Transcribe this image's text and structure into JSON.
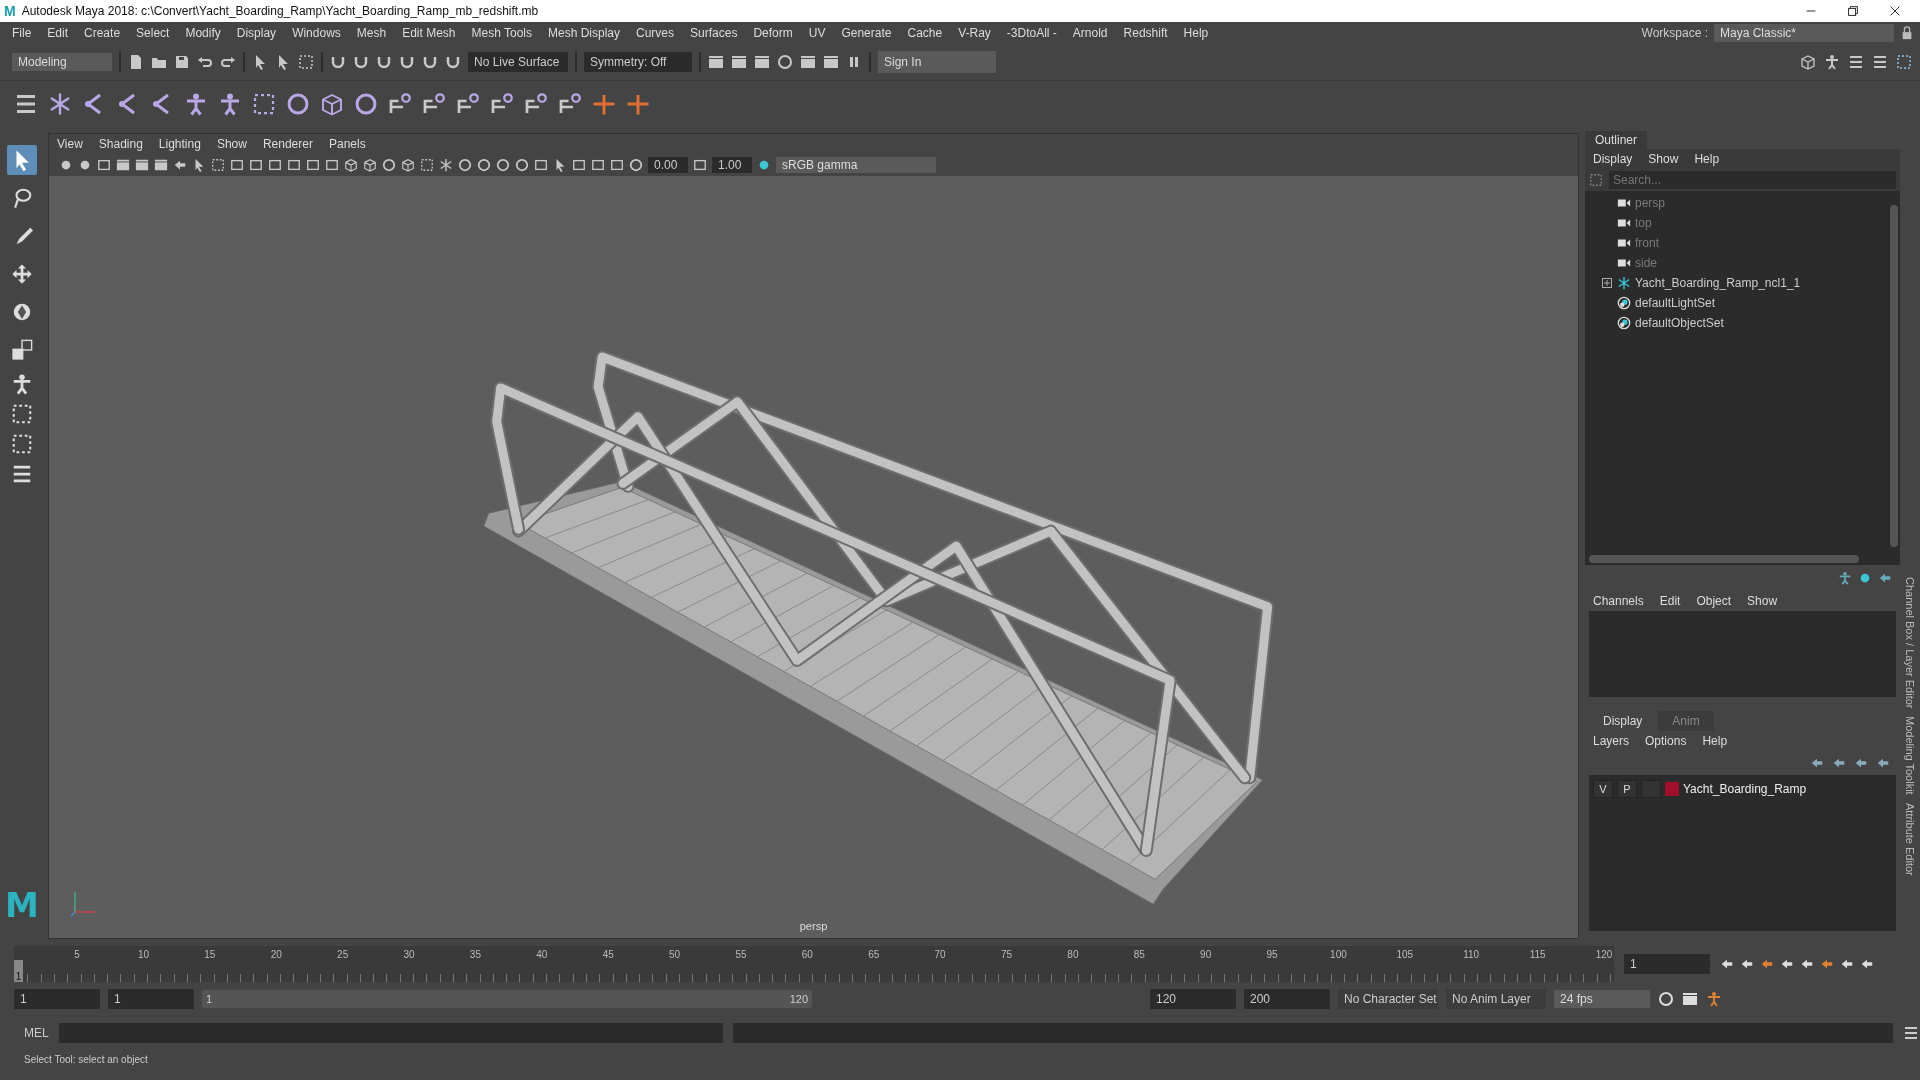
{
  "window": {
    "app_icon": "M",
    "title": "Autodesk Maya 2018: c:\\Convert\\Yacht_Boarding_Ramp\\Yacht_Boarding_Ramp_mb_redshift.mb"
  },
  "menu_bar": [
    "File",
    "Edit",
    "Create",
    "Select",
    "Modify",
    "Display",
    "Windows",
    "Mesh",
    "Edit Mesh",
    "Mesh Tools",
    "Mesh Display",
    "Curves",
    "Surfaces",
    "Deform",
    "UV",
    "Generate",
    "Cache",
    "V-Ray",
    "-3DtoAll -",
    "Arnold",
    "Redshift",
    "Help"
  ],
  "workspace": {
    "label": "Workspace :",
    "value": "Maya Classic*"
  },
  "status_line": {
    "mode": "Modeling",
    "live_surface": "No Live Surface",
    "symmetry": "Symmetry: Off",
    "sign_in": "Sign In"
  },
  "toolbox": [
    {
      "kind": "select",
      "selected": true
    },
    {
      "kind": "lasso",
      "selected": false
    },
    {
      "kind": "paint",
      "selected": false
    },
    {
      "kind": "move",
      "selected": false
    },
    {
      "kind": "rotate",
      "selected": false
    },
    {
      "kind": "scale",
      "selected": false
    }
  ],
  "viewport": {
    "menu": [
      "View",
      "Shading",
      "Lighting",
      "Show",
      "Renderer",
      "Panels"
    ],
    "exposure": "0.00",
    "gamma": "1.00",
    "color_space": "sRGB gamma",
    "camera": "persp",
    "logo": "M"
  },
  "outliner": {
    "title": "Outliner",
    "menu": [
      "Display",
      "Show",
      "Help"
    ],
    "search": {
      "placeholder": "Search..."
    },
    "items": [
      {
        "kind": "camera",
        "label": "persp",
        "expandable": false
      },
      {
        "kind": "camera",
        "label": "top",
        "expandable": false
      },
      {
        "kind": "camera",
        "label": "front",
        "expandable": false
      },
      {
        "kind": "camera",
        "label": "side",
        "expandable": false
      },
      {
        "kind": "transform",
        "label": "Yacht_Boarding_Ramp_ncl1_1",
        "expandable": true
      },
      {
        "kind": "set",
        "label": "defaultLightSet",
        "expandable": false
      },
      {
        "kind": "set",
        "label": "defaultObjectSet",
        "expandable": false
      }
    ]
  },
  "channel_box": {
    "menu": [
      "Channels",
      "Edit",
      "Object",
      "Show"
    ]
  },
  "layer_editor": {
    "tabs": [
      {
        "label": "Display",
        "selected": true
      },
      {
        "label": "Anim",
        "selected": false
      }
    ],
    "menu": [
      "Layers",
      "Options",
      "Help"
    ],
    "layers": [
      {
        "visible": "V",
        "playback": "P",
        "color": "#a0102a",
        "name": "Yacht_Boarding_Ramp"
      }
    ]
  },
  "side_tabs": [
    "Channel Box / Layer Editor",
    "Modeling Toolkit",
    "Attribute Editor"
  ],
  "timeline": {
    "current": "1",
    "ticks": [
      "5",
      "10",
      "15",
      "20",
      "25",
      "30",
      "35",
      "40",
      "45",
      "50",
      "55",
      "60",
      "65",
      "70",
      "75",
      "80",
      "85",
      "90",
      "95",
      "100",
      "105",
      "110",
      "115",
      "120"
    ],
    "frame": "1"
  },
  "range": {
    "start": "1",
    "playback_start": "1",
    "slider_start": "1",
    "slider_end": "120",
    "playback_end": "120",
    "end": "200",
    "character_set": "No Character Set",
    "anim_layer": "No Anim Layer",
    "fps": "24 fps"
  },
  "command_line": {
    "language": "MEL"
  },
  "help_line": "Select Tool: select an object"
}
